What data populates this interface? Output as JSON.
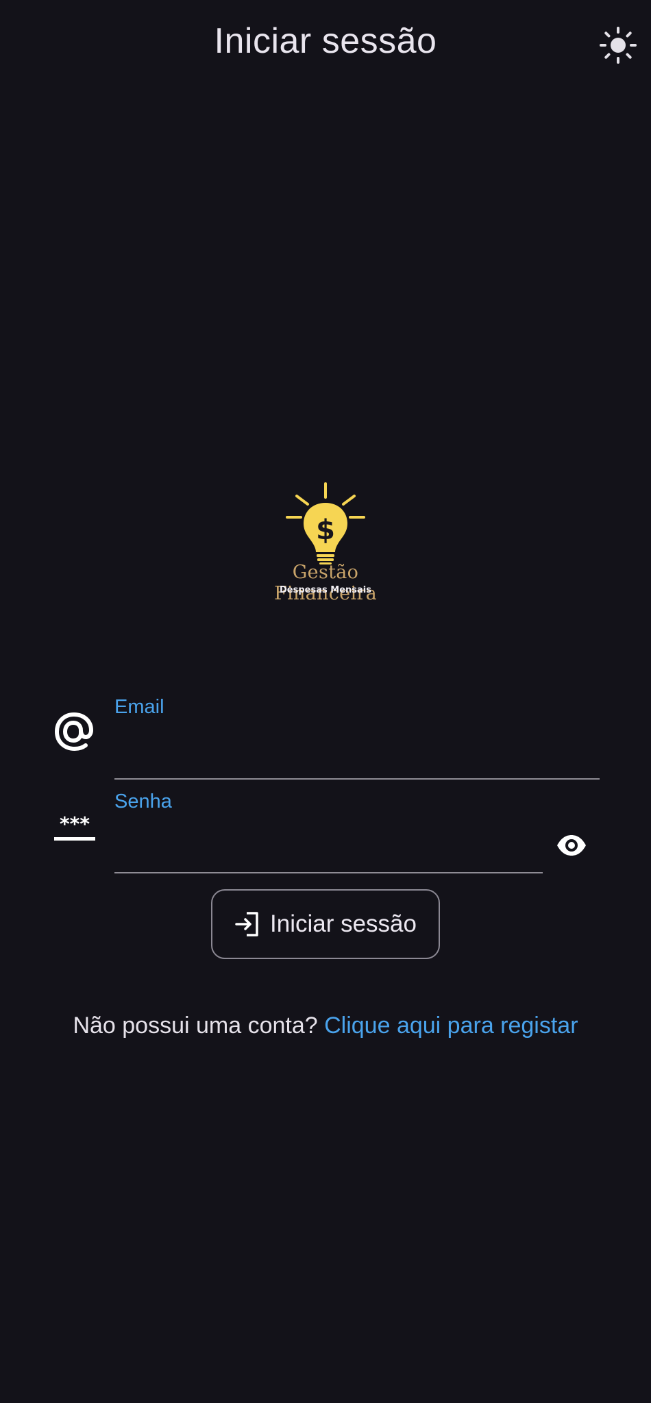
{
  "app_bar": {
    "title": "Iniciar sessão",
    "theme_toggle_icon": "sun-icon"
  },
  "logo": {
    "title": "Gestão Financeira",
    "subtitle": "Despesas Mensais",
    "icon": "lightbulb-dollar-icon",
    "colors": {
      "bulb": "#f6d553",
      "text": "#c9a46a"
    }
  },
  "form": {
    "email": {
      "label": "Email",
      "value": "",
      "icon": "at-sign-icon"
    },
    "password": {
      "label": "Senha",
      "value": "",
      "icon": "password-icon",
      "visibility_icon": "eye-icon"
    },
    "submit": {
      "label": "Iniciar sessão",
      "icon": "login-icon"
    }
  },
  "register": {
    "prompt": "Não possui uma conta?",
    "link": "Clique aqui para registar"
  },
  "colors": {
    "background": "#131219",
    "accent": "#4aa3ec",
    "text": "#e7e3ea",
    "underline": "#8f8c95"
  }
}
